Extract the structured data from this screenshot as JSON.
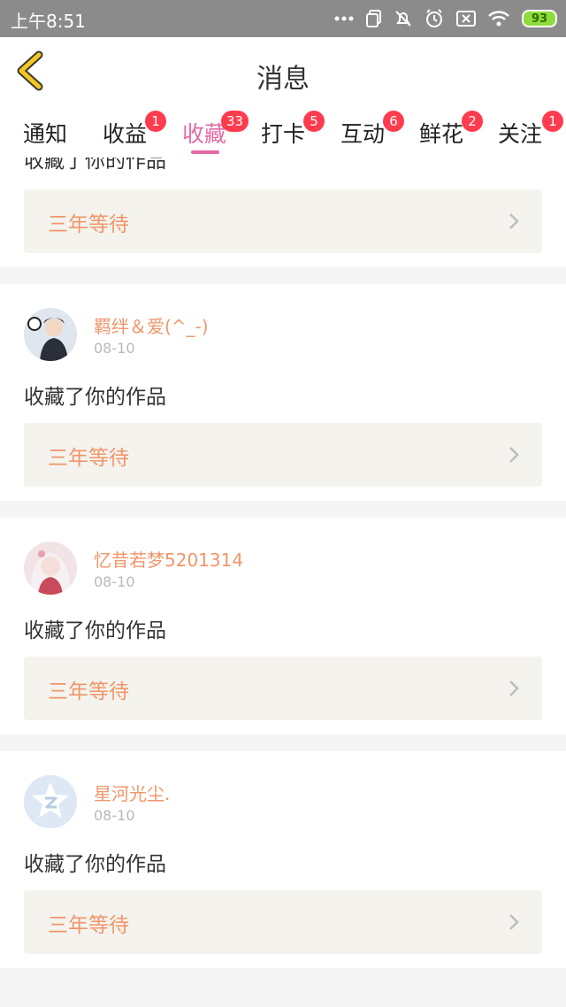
{
  "status_bar": {
    "time": "上午8:51",
    "battery": "93"
  },
  "header": {
    "title": "消息"
  },
  "tabs": [
    {
      "label": "通知",
      "badge": ""
    },
    {
      "label": "收益",
      "badge": "1"
    },
    {
      "label": "收藏",
      "badge": "33"
    },
    {
      "label": "打卡",
      "badge": "5"
    },
    {
      "label": "互动",
      "badge": "6"
    },
    {
      "label": "鲜花",
      "badge": "2"
    },
    {
      "label": "关注",
      "badge": "1"
    }
  ],
  "feed": {
    "top_partial": {
      "action": "收藏了你的作品",
      "work_title": "三年等待"
    },
    "items": [
      {
        "username": "羁绊＆爱(^_-)",
        "date": "08-10",
        "action": "收藏了你的作品",
        "work_title": "三年等待"
      },
      {
        "username": "忆昔若梦5201314",
        "date": "08-10",
        "action": "收藏了你的作品",
        "work_title": "三年等待"
      },
      {
        "username": "星河光尘.",
        "date": "08-10",
        "action": "收藏了你的作品",
        "work_title": "三年等待"
      }
    ]
  },
  "colors": {
    "accent_pink": "#e36aa5",
    "username_orange": "#f0966a",
    "badge_red": "#ff3b4e",
    "back_arrow_yellow": "#f5c623"
  }
}
